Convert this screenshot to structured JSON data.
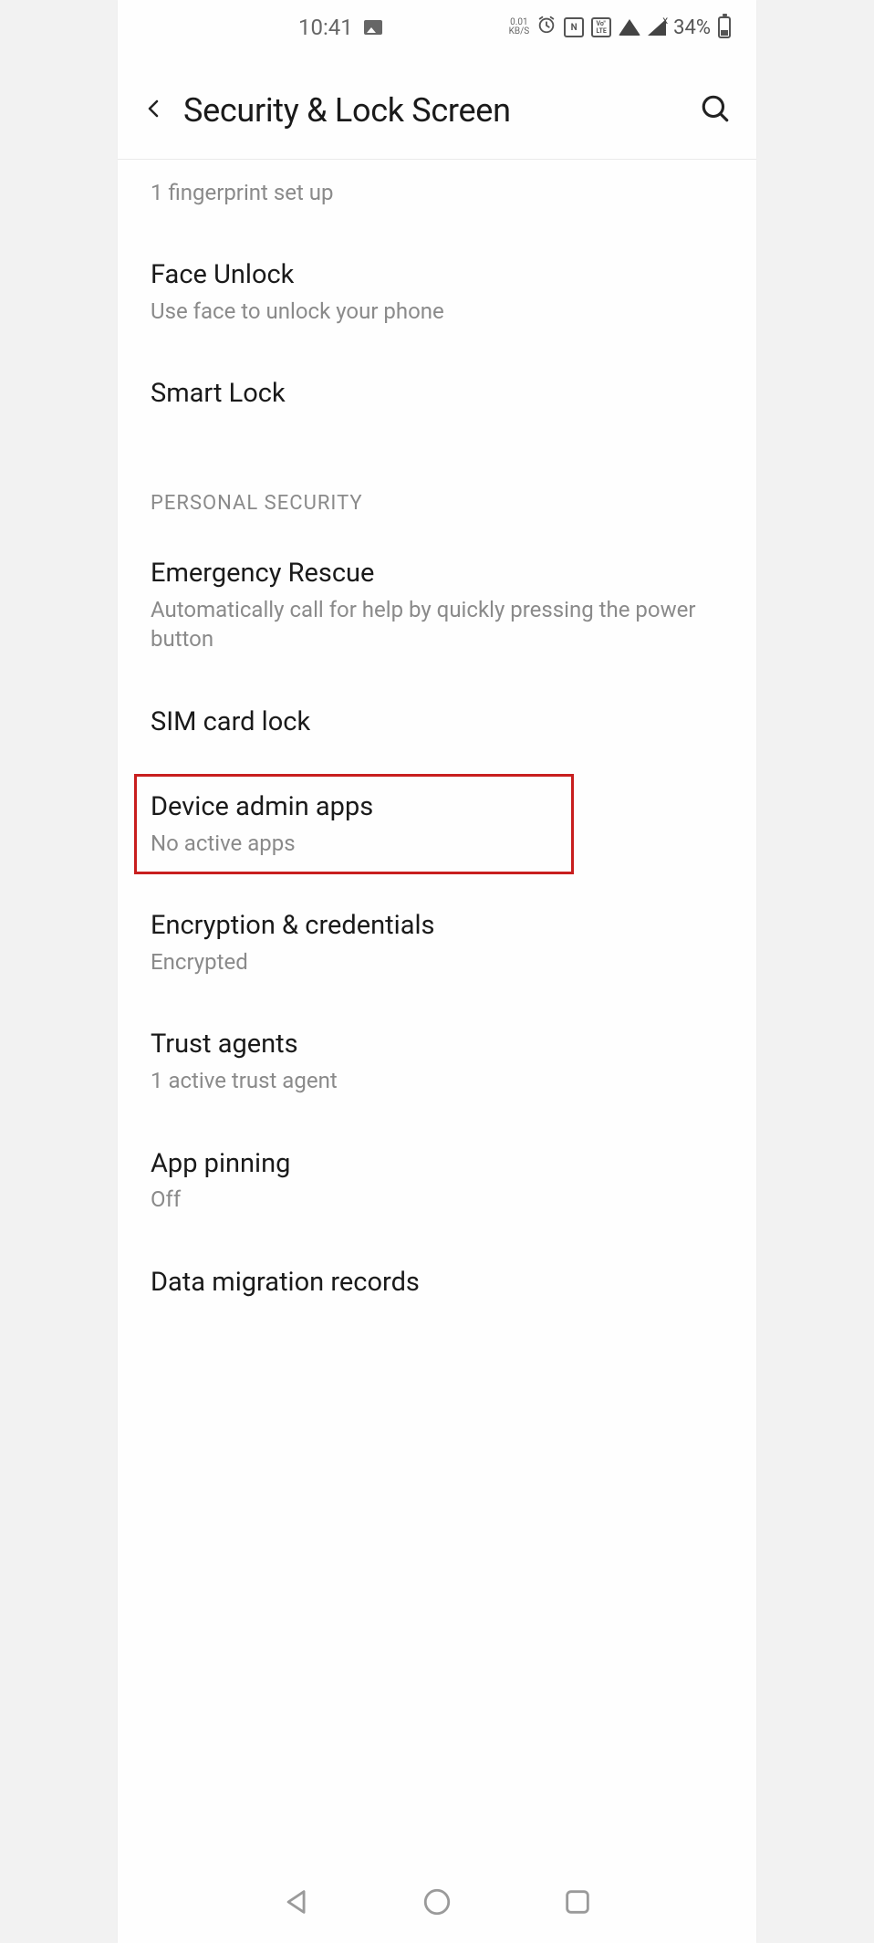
{
  "status": {
    "time": "10:41",
    "speed_top": "0.01",
    "speed_bottom": "KB/S",
    "nfc": "N",
    "volte": "Vo\"\nLTE",
    "battery_pct": "34%"
  },
  "header": {
    "title": "Security & Lock Screen"
  },
  "partial_top_item": {
    "sub": "1 fingerprint set up"
  },
  "items_pre": [
    {
      "title": "Face Unlock",
      "sub": "Use face to unlock your phone"
    },
    {
      "title": "Smart Lock",
      "sub": ""
    }
  ],
  "section_label": "PERSONAL SECURITY",
  "items_section": [
    {
      "title": "Emergency Rescue",
      "sub": "Automatically call for help by quickly pressing the power button",
      "boxed": false
    },
    {
      "title": "SIM card lock",
      "sub": "",
      "boxed": false
    },
    {
      "title": "Device admin apps",
      "sub": "No active apps",
      "boxed": true
    },
    {
      "title": "Encryption & credentials",
      "sub": "Encrypted",
      "boxed": false
    },
    {
      "title": "Trust agents",
      "sub": "1 active trust agent",
      "boxed": false
    },
    {
      "title": "App pinning",
      "sub": "Off",
      "boxed": false
    },
    {
      "title": "Data migration records",
      "sub": "",
      "boxed": false
    }
  ]
}
